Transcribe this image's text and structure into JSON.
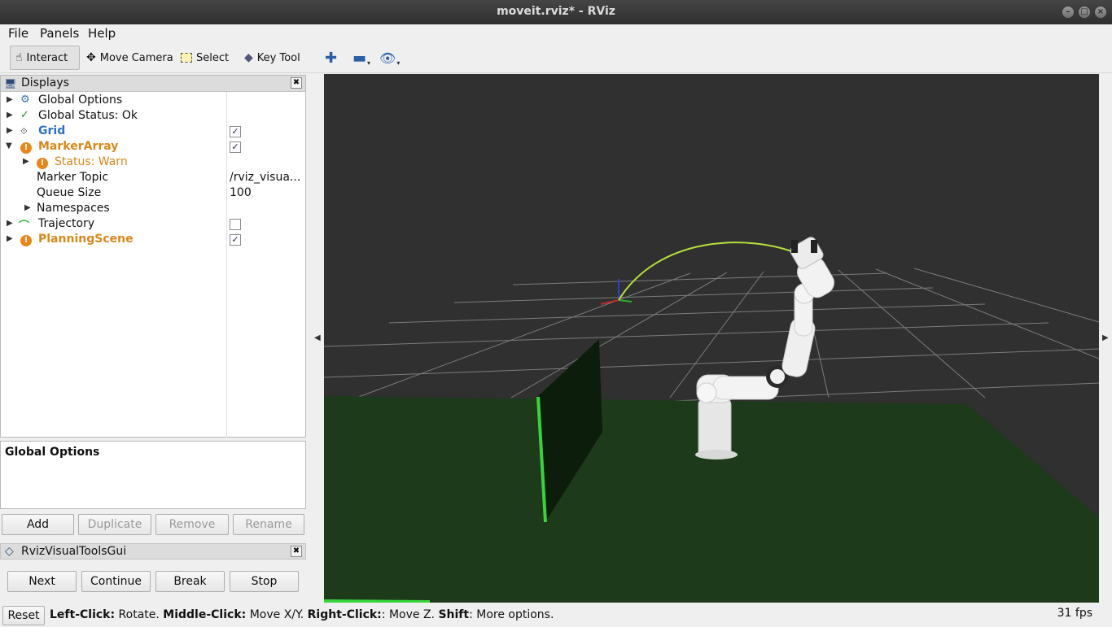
{
  "window": {
    "title": "moveit.rviz* - RViz"
  },
  "menu": {
    "file": "File",
    "panels": "Panels",
    "help": "Help"
  },
  "toolbar": {
    "interact": "Interact",
    "move_camera": "Move Camera",
    "select": "Select",
    "key_tool": "Key Tool"
  },
  "displays": {
    "title": "Displays",
    "items": [
      {
        "label": "Global Options",
        "icon": "gear-icon"
      },
      {
        "label": "Global Status: Ok",
        "icon": "checkmark-icon"
      },
      {
        "label": "Grid",
        "icon": "grid-icon",
        "checked": true
      },
      {
        "label": "MarkerArray",
        "icon": "warning-icon",
        "checked": true
      },
      {
        "label": "Status: Warn",
        "icon": "warning-icon"
      },
      {
        "label": "Marker Topic",
        "value": "/rviz_visua..."
      },
      {
        "label": "Queue Size",
        "value": "100"
      },
      {
        "label": "Namespaces"
      },
      {
        "label": "Trajectory",
        "icon": "trajectory-icon",
        "checked": false
      },
      {
        "label": "PlanningScene",
        "icon": "warning-icon",
        "checked": true
      }
    ]
  },
  "description": {
    "title": "Global Options"
  },
  "display_buttons": {
    "add": "Add",
    "duplicate": "Duplicate",
    "remove": "Remove",
    "rename": "Rename"
  },
  "rviz_visual_tools": {
    "title": "RvizVisualToolsGui",
    "next": "Next",
    "continue": "Continue",
    "break": "Break",
    "stop": "Stop"
  },
  "status": {
    "reset": "Reset",
    "left_click_key": "Left-Click:",
    "left_click_action": " Rotate. ",
    "middle_click_key": "Middle-Click:",
    "middle_click_action": " Move X/Y. ",
    "right_click_key": "Right-Click:",
    "right_click_action": ": Move Z. ",
    "shift_key": "Shift",
    "shift_action": ": More options.",
    "fps": "31 fps"
  },
  "colors": {
    "viewport_bg": "#303030",
    "ground": "#1d3a1a",
    "grid_line": "#8a8a8a",
    "trajectory": "#b6e13a",
    "accent_blue": "#2a72c8",
    "warn_orange": "#d9881a"
  }
}
